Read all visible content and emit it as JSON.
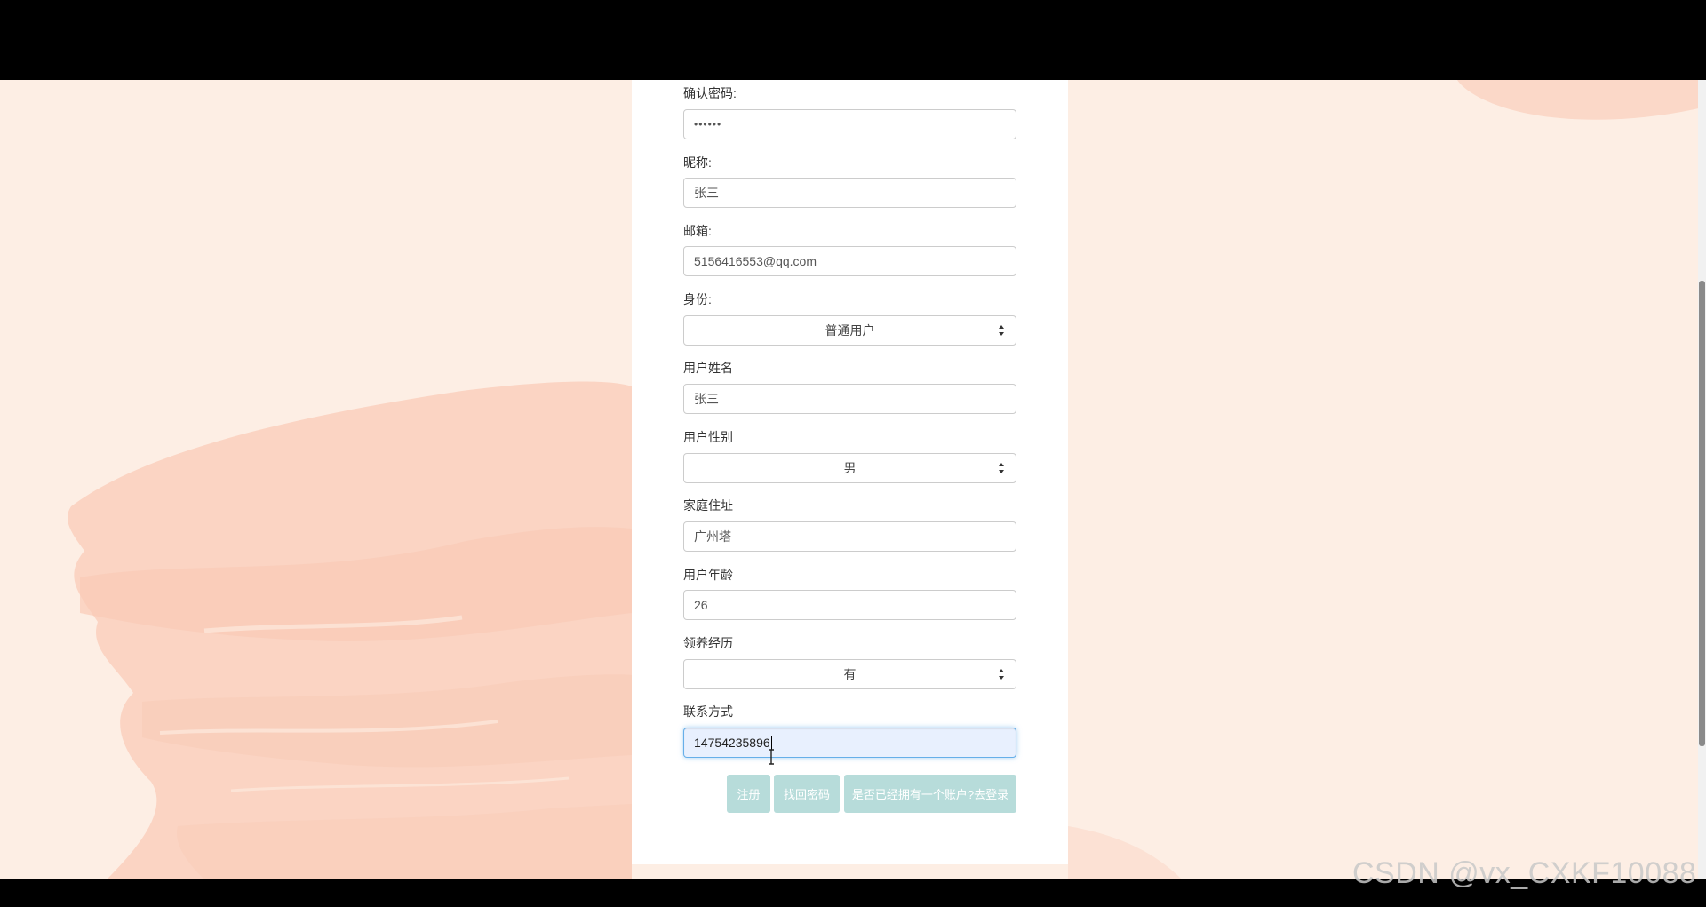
{
  "form": {
    "confirm_password": {
      "label": "确认密码:",
      "value": "••••••"
    },
    "nickname": {
      "label": "昵称:",
      "value": "张三"
    },
    "email": {
      "label": "邮箱:",
      "value": "5156416553@qq.com"
    },
    "identity": {
      "label": "身份:",
      "selected": "普通用户"
    },
    "user_name": {
      "label": "用户姓名",
      "value": "张三"
    },
    "user_gender": {
      "label": "用户性别",
      "selected": "男"
    },
    "home_address": {
      "label": "家庭住址",
      "value": "广州塔"
    },
    "user_age": {
      "label": "用户年龄",
      "value": "26"
    },
    "adoption_experience": {
      "label": "领养经历",
      "selected": "有"
    },
    "contact": {
      "label": "联系方式",
      "value": "14754235896"
    }
  },
  "buttons": {
    "register": "注册",
    "find_password": "找回密码",
    "login_link": "是否已经拥有一个账户?去登录"
  },
  "watermark": "CSDN @vx_CXKF10088",
  "colors": {
    "background": "#fdeee4",
    "brush": "#fbd3c2",
    "button": "#b7dcda",
    "focus_border": "#66afe9"
  }
}
